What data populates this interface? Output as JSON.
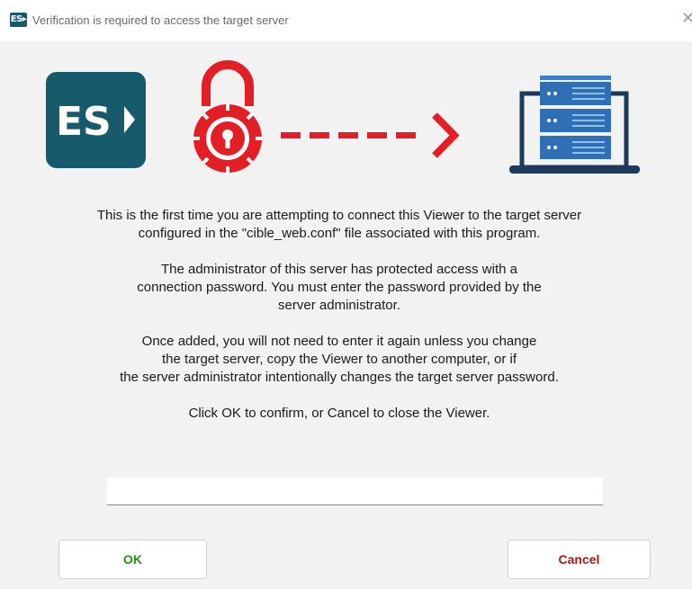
{
  "window": {
    "title": "Verification is required to access the target server",
    "logo_text": "ES▸",
    "close_glyph": "✕"
  },
  "illustration": {
    "app_logo_text": "ES",
    "icons": [
      "es-app-logo",
      "padlock-icon",
      "dashed-arrow",
      "server-laptop-icon"
    ],
    "colors": {
      "brand": "#175a6b",
      "lock": "#e31e24",
      "server": "#2f6fb5",
      "laptop": "#1d3a5c"
    }
  },
  "message": {
    "para1": [
      "This is the first time you are attempting to connect this Viewer to the target server",
      "configured in the \"cible_web.conf\" file associated with this program."
    ],
    "para2": [
      "The administrator of this server has protected access with a",
      "connection password. You must enter the password provided by the",
      "server administrator."
    ],
    "para3": [
      "Once added, you will not need to enter it again unless you change",
      "the target server, copy the Viewer to another computer, or if",
      "the server administrator intentionally changes the target server password."
    ],
    "para4": [
      "Click OK to confirm, or Cancel to close the Viewer."
    ]
  },
  "password_field": {
    "value": "",
    "placeholder": ""
  },
  "buttons": {
    "ok_label": "OK",
    "cancel_label": "Cancel"
  }
}
